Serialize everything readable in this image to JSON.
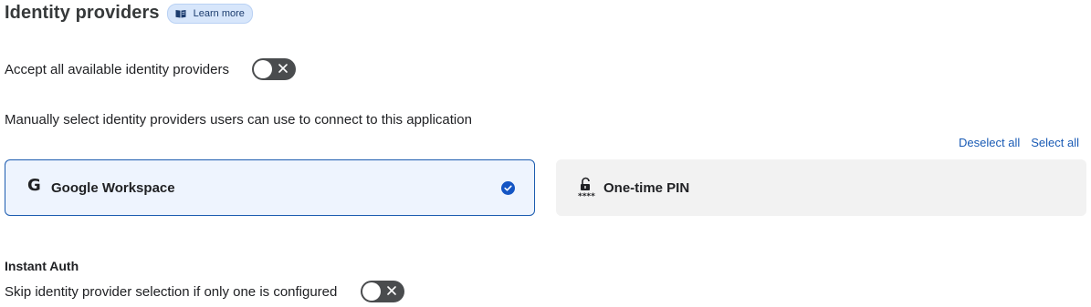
{
  "header": {
    "title": "Identity providers",
    "learn_more_label": "Learn more"
  },
  "accept_all": {
    "label": "Accept all available identity providers",
    "enabled": false
  },
  "manual_select": {
    "label": "Manually select identity providers users can use to connect to this application"
  },
  "selection_links": {
    "deselect_all": "Deselect all",
    "select_all": "Select all"
  },
  "providers": [
    {
      "label": "Google Workspace",
      "icon": "google-g-icon",
      "selected": true
    },
    {
      "label": "One-time PIN",
      "icon": "unlocked-pin-icon",
      "selected": false
    }
  ],
  "instant_auth": {
    "title": "Instant Auth",
    "label": "Skip identity provider selection if only one is configured",
    "enabled": false
  },
  "colors": {
    "accent": "#1455c4",
    "selected_card_bg": "#eef4fe",
    "toggle_off": "#4a4c4e"
  }
}
